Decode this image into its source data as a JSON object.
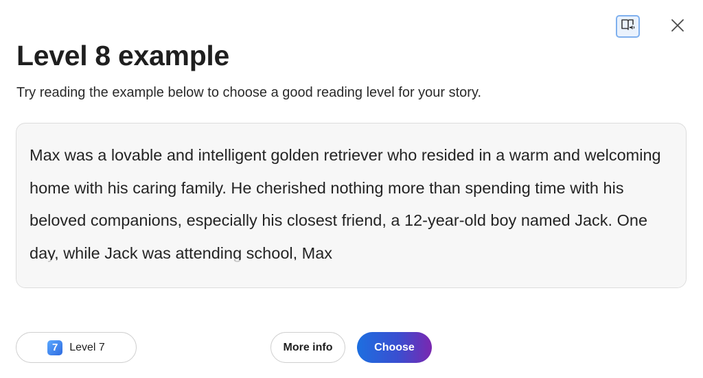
{
  "header": {
    "title": "Level 8 example",
    "subtitle": "Try reading the example below to choose a good reading level for your story.",
    "reader_icon": "immersive-reader-icon",
    "close_icon": "close-icon"
  },
  "example": {
    "text": "Max was a lovable and intelligent golden retriever who resided in a warm and welcoming home with his caring family. He cherished nothing more than spending time with his beloved companions, especially his closest friend, a 12-year-old boy named Jack. One day, while Jack was attending school, Max"
  },
  "footer": {
    "level_button": {
      "badge": "7",
      "label": "Level 7"
    },
    "more_info_label": "More info",
    "choose_label": "Choose"
  },
  "colors": {
    "reader_border": "#7fb0ee",
    "choose_gradient_start": "#1d6fe0",
    "choose_gradient_end": "#7a27b0",
    "level_badge": "#2f6ce0"
  }
}
